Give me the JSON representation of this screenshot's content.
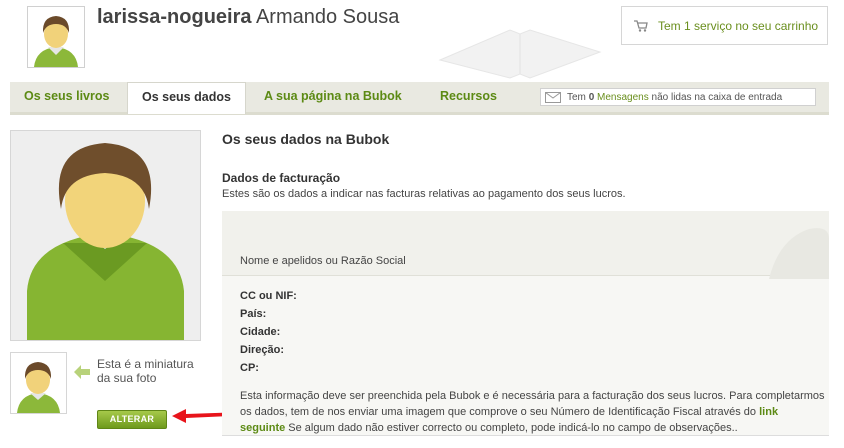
{
  "header": {
    "username": "larissa-nogueira",
    "full_name": "Armando Sousa",
    "cart_text": "Tem 1 serviço no seu carrinho",
    "cart_icon": "cart-icon"
  },
  "tabs": [
    {
      "label": "Os seus livros",
      "active": false
    },
    {
      "label": "Os seus dados",
      "active": true
    },
    {
      "label": "A sua página na Bubok",
      "active": false
    },
    {
      "label": "Recursos",
      "active": false
    }
  ],
  "messages": {
    "prefix": "Tem",
    "count": "0",
    "link": "Mensagens",
    "suffix": "não lidas na caixa de entrada"
  },
  "sidebar": {
    "thumb_text": "Esta é a miniatura da sua foto",
    "change_button": "ALTERAR"
  },
  "main": {
    "title": "Os seus dados na Bubok",
    "billing_title": "Dados de facturação",
    "billing_desc": "Estes são os dados a indicar nas facturas relativas ao pagamento dos seus lucros.",
    "name_label": "Nome e apelidos ou Razão Social",
    "fields": [
      "CC ou NIF:",
      "País:",
      "Cidade:",
      "Direção:",
      "CP:"
    ],
    "note_before": "Esta informação deve ser preenchida pela Bubok e é necessária para a facturação dos seus lucros. Para completarmos os dados, tem de nos enviar uma imagem que comprove o seu Número de Identificação Fiscal através do",
    "note_link": "link seguinte",
    "note_after": "Se algum dado não estiver correcto ou completo, pode indicá-lo no campo de observações.."
  },
  "colors": {
    "accent": "#6a8f1e",
    "arrow": "#e8141b",
    "tabbar": "#e9e9e1"
  }
}
